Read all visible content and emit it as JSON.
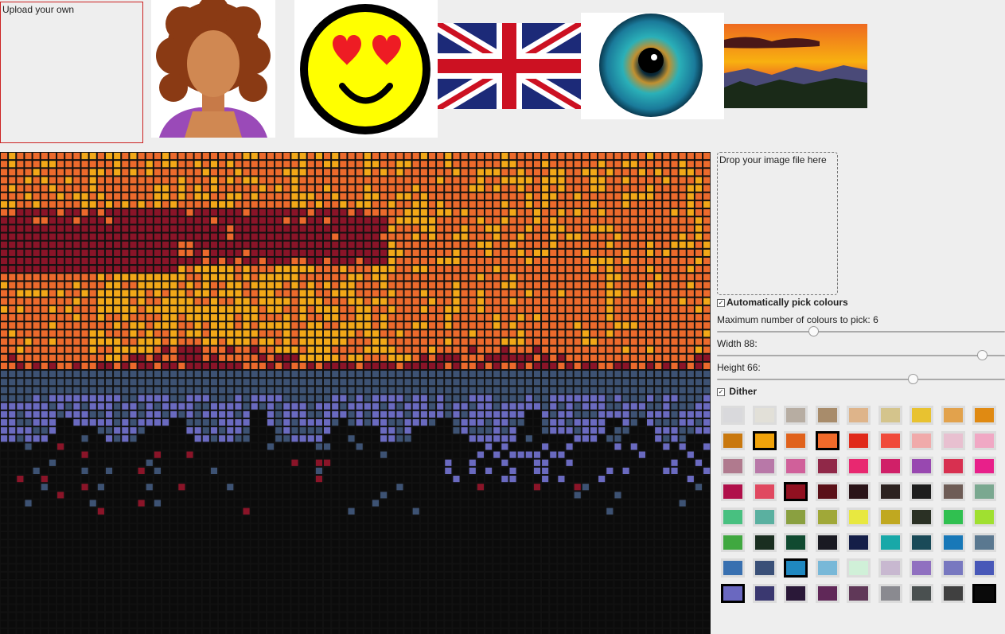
{
  "upload": {
    "label": "Upload your own"
  },
  "dropzone": {
    "label": "Drop your image file here"
  },
  "options": {
    "auto_pick_label": "Automatically pick colours",
    "auto_pick_checked": true,
    "max_colours_label": "Maximum number of colours to pick: 6",
    "max_colours_value": 6,
    "width_label": "Width 88:",
    "width_value": 88,
    "height_label": "Height 66:",
    "height_value": 66,
    "dither_label": "Dither",
    "dither_checked": true
  },
  "thumbnails": [
    "avatar-woman",
    "heart-eyes-emoji",
    "union-jack-flag",
    "eye-iris",
    "sunset-landscape"
  ],
  "palette": [
    "#d9d9dc",
    "#e2e0d8",
    "#b7ada2",
    "#a88c6b",
    "#deb48a",
    "#d4c48c",
    "#e8c230",
    "#e2a24c",
    "#e08a12",
    "#c9780e",
    "#f0a20a",
    "#e0621c",
    "#f06a2a",
    "#e02a1a",
    "#f04a3a",
    "#f0aaaa",
    "#e8c0d0",
    "#f0a8c4",
    "#b07a8e",
    "#b878a8",
    "#d0609a",
    "#902848",
    "#e82870",
    "#d02068",
    "#9848b0",
    "#d83050",
    "#e8208a",
    "#b0104a",
    "#e04860",
    "#901020",
    "#5a1018",
    "#2a1418",
    "#2c2220",
    "#1e1e1e",
    "#6e5c56",
    "#7aa890",
    "#48c080",
    "#5ab0a0",
    "#8aa040",
    "#a0a838",
    "#e8e840",
    "#c0a820",
    "#2a3024",
    "#30c050",
    "#a0e030",
    "#40a840",
    "#1a2e20",
    "#104a30",
    "#1a1a22",
    "#141e48",
    "#18a8a8",
    "#1a4a58",
    "#1878b8",
    "#5a7890",
    "#3870b0",
    "#3a5078",
    "#1f88c0",
    "#78b8d8",
    "#d0f0d8",
    "#c8b8d0",
    "#9070c0",
    "#7878c0",
    "#4858b8",
    "#6a68c0",
    "#3a3870",
    "#2a1838",
    "#602858",
    "#603858",
    "#8a8a90",
    "#4a5050",
    "#404040",
    "#0a0a0a"
  ],
  "selected_colours": [
    10,
    12,
    29,
    56,
    63,
    71
  ],
  "pattern": {
    "cols": 88,
    "rows": 60,
    "colours": {
      "orange": "#ec6a2c",
      "yellow": "#f2a818",
      "maroon": "#8a1428",
      "slate": "#3d5273",
      "periwinkle": "#6a6ac0",
      "black": "#0b0b0b"
    }
  }
}
